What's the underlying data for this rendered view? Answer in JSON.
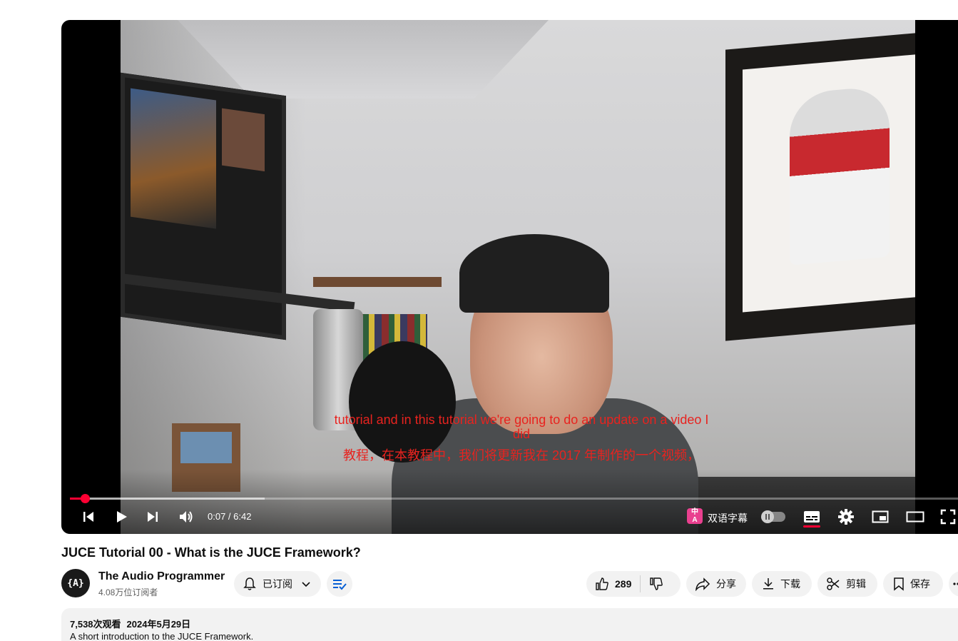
{
  "player": {
    "captions": {
      "en_line1": "tutorial and in this tutorial we're going to do an update on a video I",
      "en_line2": "did",
      "zh": "教程，在本教程中，我们将更新我在 2017 年制作的一个视频，"
    },
    "time_display": "0:07 / 6:42",
    "progress_fraction": 0.017,
    "buffer_fraction": 0.212,
    "bilingual_badge": "中\nA",
    "bilingual_label": "双语字幕",
    "accent_color": "#ff0033",
    "caption_color": "#e8231f",
    "controls": [
      "previous-icon",
      "play-icon",
      "next-icon",
      "volume-icon",
      "autoplay-toggle",
      "subtitles-icon",
      "settings-icon",
      "miniplayer-icon",
      "theater-icon",
      "fullscreen-icon"
    ]
  },
  "video": {
    "title": "JUCE Tutorial 00 - What is the JUCE Framework?"
  },
  "channel": {
    "avatar_text": "{A}",
    "name": "The Audio Programmer",
    "subscribers": "4.08万位订阅者",
    "subscribed_label": "已订阅"
  },
  "actions": {
    "likes": "289",
    "share": "分享",
    "download": "下载",
    "clip": "剪辑",
    "save": "保存"
  },
  "description": {
    "views": "7,538次观看",
    "date": "2024年5月29日",
    "text": "A short introduction to the JUCE Framework."
  }
}
